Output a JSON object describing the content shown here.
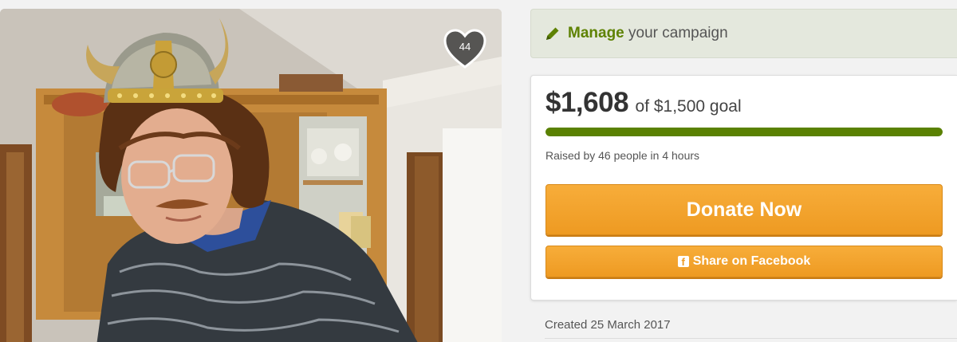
{
  "photo": {
    "alt": "campaign-photo",
    "heart_count": "44"
  },
  "manage": {
    "strong": "Manage",
    "rest": "your campaign",
    "icon": "pencil-icon",
    "accent": "#5e8203"
  },
  "donation": {
    "raised": "$1,608",
    "goal_text": "of $1,500 goal",
    "progress_fraction": 1.0,
    "raised_by": "Raised by 46 people in 4 hours",
    "progress_color": "#5a8102"
  },
  "buttons": {
    "donate_label": "Donate Now",
    "share_label": "Share on Facebook",
    "share_icon": "facebook-icon",
    "button_color": "#ee9a22"
  },
  "meta": {
    "created": "Created 25 March 2017"
  }
}
